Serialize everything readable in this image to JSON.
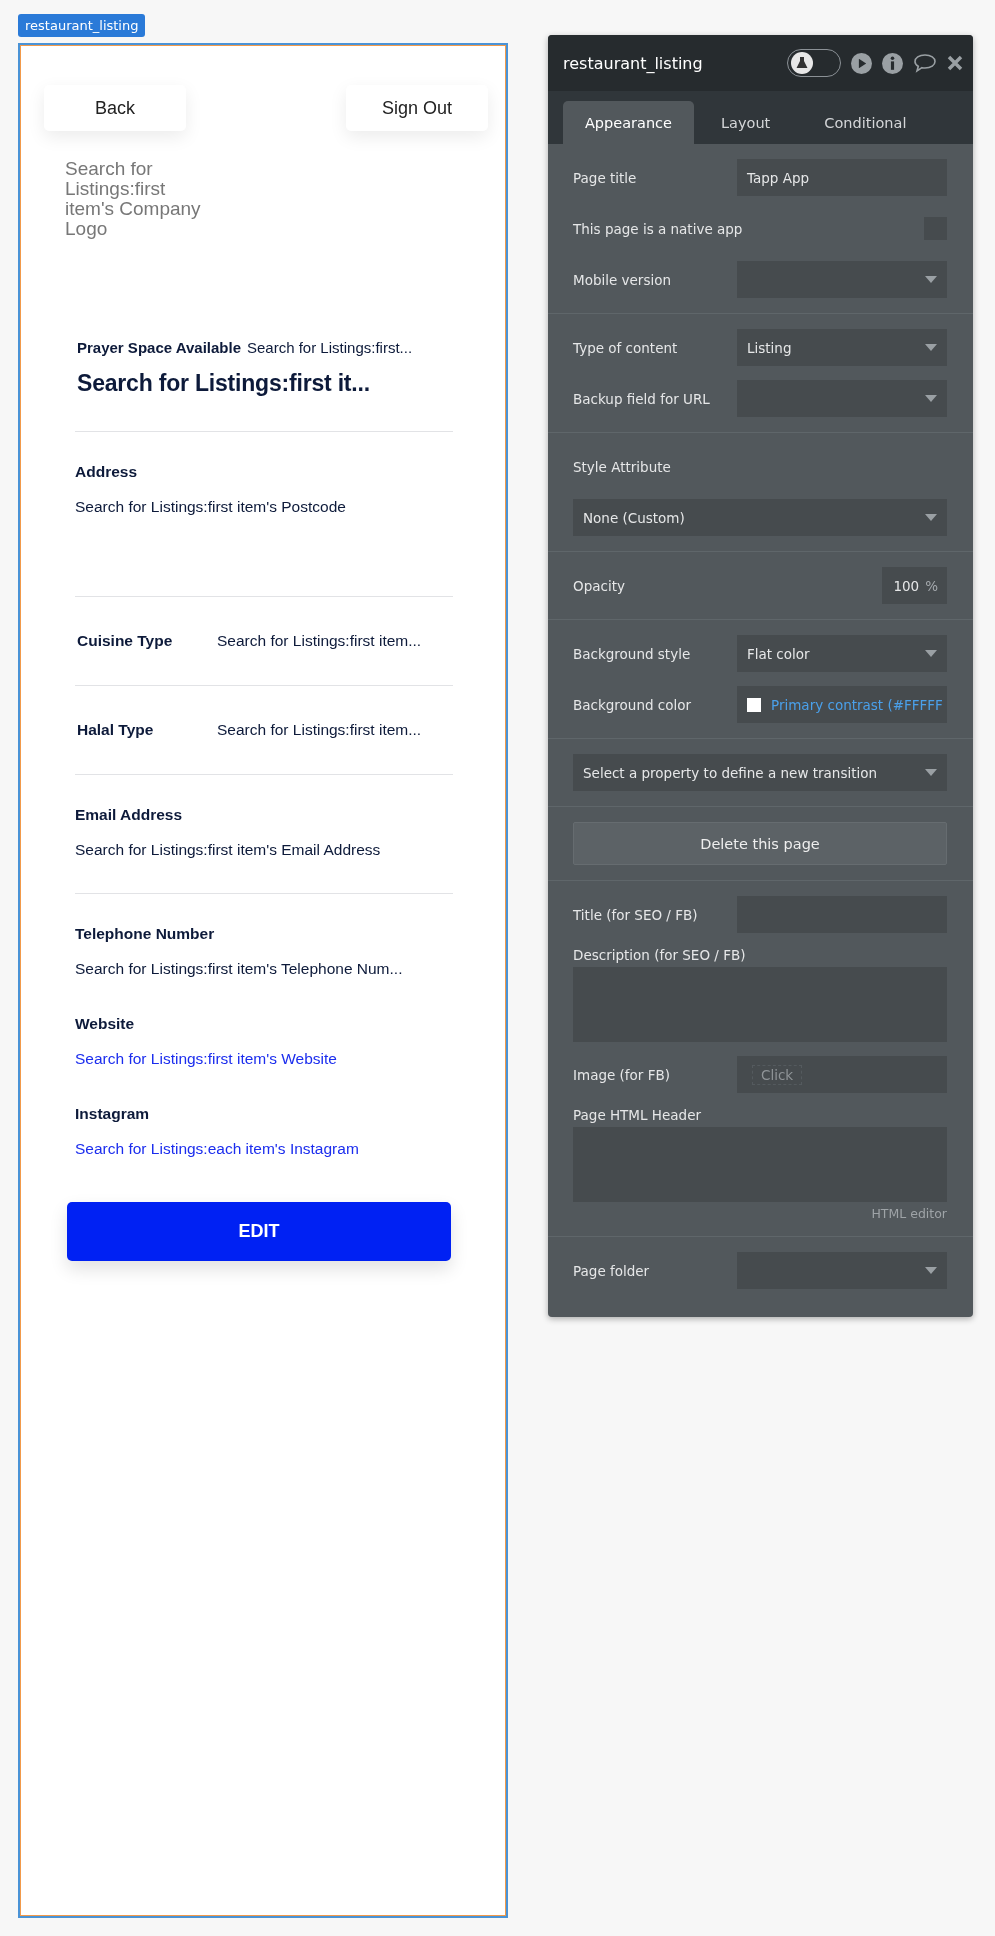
{
  "page_label": "restaurant_listing",
  "preview": {
    "nav_buttons": [
      "Back",
      "Sign Out"
    ],
    "logo_text": "Search for Listings:first item's Company Logo",
    "prayer_label": "Prayer Space Available",
    "prayer_value": "Search for Listings:first...",
    "title": "Search for Listings:first it...",
    "sections": [
      {
        "kind": "stacked",
        "label": "Address",
        "value": "Search for Listings:first item's Postcode",
        "link": false,
        "divider": true
      },
      {
        "kind": "inline",
        "label": "Cuisine Type",
        "value": "Search for Listings:first item...",
        "link": false,
        "divider": true
      },
      {
        "kind": "inline",
        "label": "Halal Type",
        "value": "Search for Listings:first item...",
        "link": false,
        "divider": true
      },
      {
        "kind": "stacked",
        "label": "Email Address",
        "value": "Search for Listings:first item's Email Address",
        "link": false,
        "divider": true
      },
      {
        "kind": "stacked",
        "label": "Telephone Number",
        "value": "Search for Listings:first item's Telephone Num...",
        "link": false,
        "divider": false
      },
      {
        "kind": "stacked",
        "label": "Website",
        "value": "Search for Listings:first item's Website",
        "link": true,
        "divider": false
      },
      {
        "kind": "stacked",
        "label": "Instagram",
        "value": "Search for Listings:each item's Instagram",
        "link": true,
        "divider": false
      }
    ],
    "edit_button": "EDIT"
  },
  "panel": {
    "title": "restaurant_listing",
    "toggle_on": false,
    "tabs": [
      {
        "label": "Appearance",
        "selected": true
      },
      {
        "label": "Layout",
        "selected": false
      },
      {
        "label": "Conditional",
        "selected": false
      }
    ],
    "groups": [
      [
        {
          "kind": "input",
          "label": "Page title",
          "value": "Tapp App"
        },
        {
          "kind": "checkbox",
          "label": "This page is a native app",
          "checked": false
        },
        {
          "kind": "select",
          "label": "Mobile version"
        }
      ],
      [
        {
          "kind": "select",
          "label": "Type of content",
          "value": "Listing"
        },
        {
          "kind": "select",
          "label": "Backup field for URL"
        }
      ],
      [
        {
          "kind": "heading",
          "label": "Style Attribute"
        },
        {
          "kind": "wide_select",
          "value": "None (Custom)"
        }
      ],
      [
        {
          "kind": "percent",
          "label": "Opacity",
          "value": "100",
          "unit": "%"
        }
      ],
      [
        {
          "kind": "select",
          "label": "Background style",
          "value": "Flat color"
        },
        {
          "kind": "color",
          "label": "Background color",
          "color": "#ffffff",
          "value": "Primary contrast (#FFFFF"
        }
      ],
      [
        {
          "kind": "wide_select",
          "value": "Select a property to define a new transition"
        }
      ],
      [
        {
          "kind": "button",
          "label": "Delete this page"
        }
      ],
      [
        {
          "kind": "input",
          "label": "Title (for SEO / FB)"
        },
        {
          "kind": "textarea",
          "label": "Description (for SEO / FB)"
        },
        {
          "kind": "file",
          "label": "Image (for FB)",
          "placeholder": "Click"
        },
        {
          "kind": "textarea",
          "label": "Page HTML Header",
          "note": "HTML editor"
        }
      ],
      [
        {
          "kind": "select",
          "label": "Page folder"
        }
      ]
    ]
  }
}
